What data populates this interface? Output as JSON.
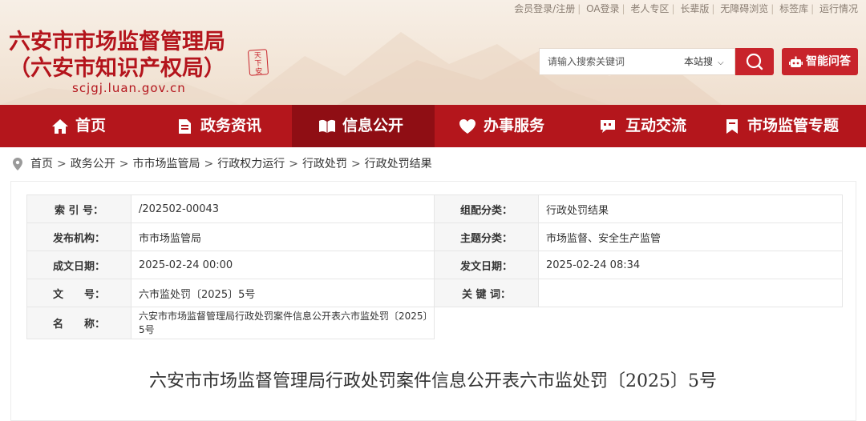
{
  "top_links": [
    "会员登录/注册",
    "OA登录",
    "老人专区",
    "长辈版",
    "无障碍浏览",
    "标签库",
    "运行情况"
  ],
  "site": {
    "title_line1": "六安市市场监督管理局",
    "title_line2": "（六安市知识产权局）",
    "url": "scjgj.luan.gov.cn",
    "seal_text": "天下安"
  },
  "search": {
    "placeholder": "请输入搜索关键词",
    "scope": "本站搜",
    "button_icon": "search-icon"
  },
  "ai_button": {
    "label": "智能问答",
    "icon": "robot-icon"
  },
  "nav": [
    {
      "label": "首页",
      "icon": "home-icon"
    },
    {
      "label": "政务资讯",
      "icon": "document-icon"
    },
    {
      "label": "信息公开",
      "icon": "open-book-icon",
      "active": true
    },
    {
      "label": "办事服务",
      "icon": "heart-icon"
    },
    {
      "label": "互动交流",
      "icon": "chat-icon"
    },
    {
      "label": "市场监管专题",
      "icon": "bookmark-icon"
    }
  ],
  "breadcrumb": [
    "首页",
    "政务公开",
    "市市场监管局",
    "行政权力运行",
    "行政处罚",
    "行政处罚结果"
  ],
  "meta": {
    "index_label": "索 引 号：",
    "index_value": "/202502-00043",
    "category_label": "组配分类：",
    "category_value": "行政处罚结果",
    "publisher_label": "发布机构：",
    "publisher_value": "市市场监管局",
    "topic_label": "主题分类：",
    "topic_value": "市场监督、安全生产监管",
    "created_label": "成文日期：",
    "created_value": "2025-02-24 00:00",
    "issued_label": "发文日期：",
    "issued_value": "2025-02-24 08:34",
    "docno_label": "文　　号：",
    "docno_value": "六市监处罚〔2025〕5号",
    "keywords_label": "关 键 词：",
    "keywords_value": "",
    "name_label": "名　　称：",
    "name_value": "六安市市场监督管理局行政处罚案件信息公开表六市监处罚〔2025〕5号"
  },
  "document_title": "六安市市场监督管理局行政处罚案件信息公开表六市监处罚〔2025〕5号",
  "colors": {
    "brand_red": "#b4161c",
    "nav_active": "#8f0e14",
    "button_red": "#c8242b"
  }
}
